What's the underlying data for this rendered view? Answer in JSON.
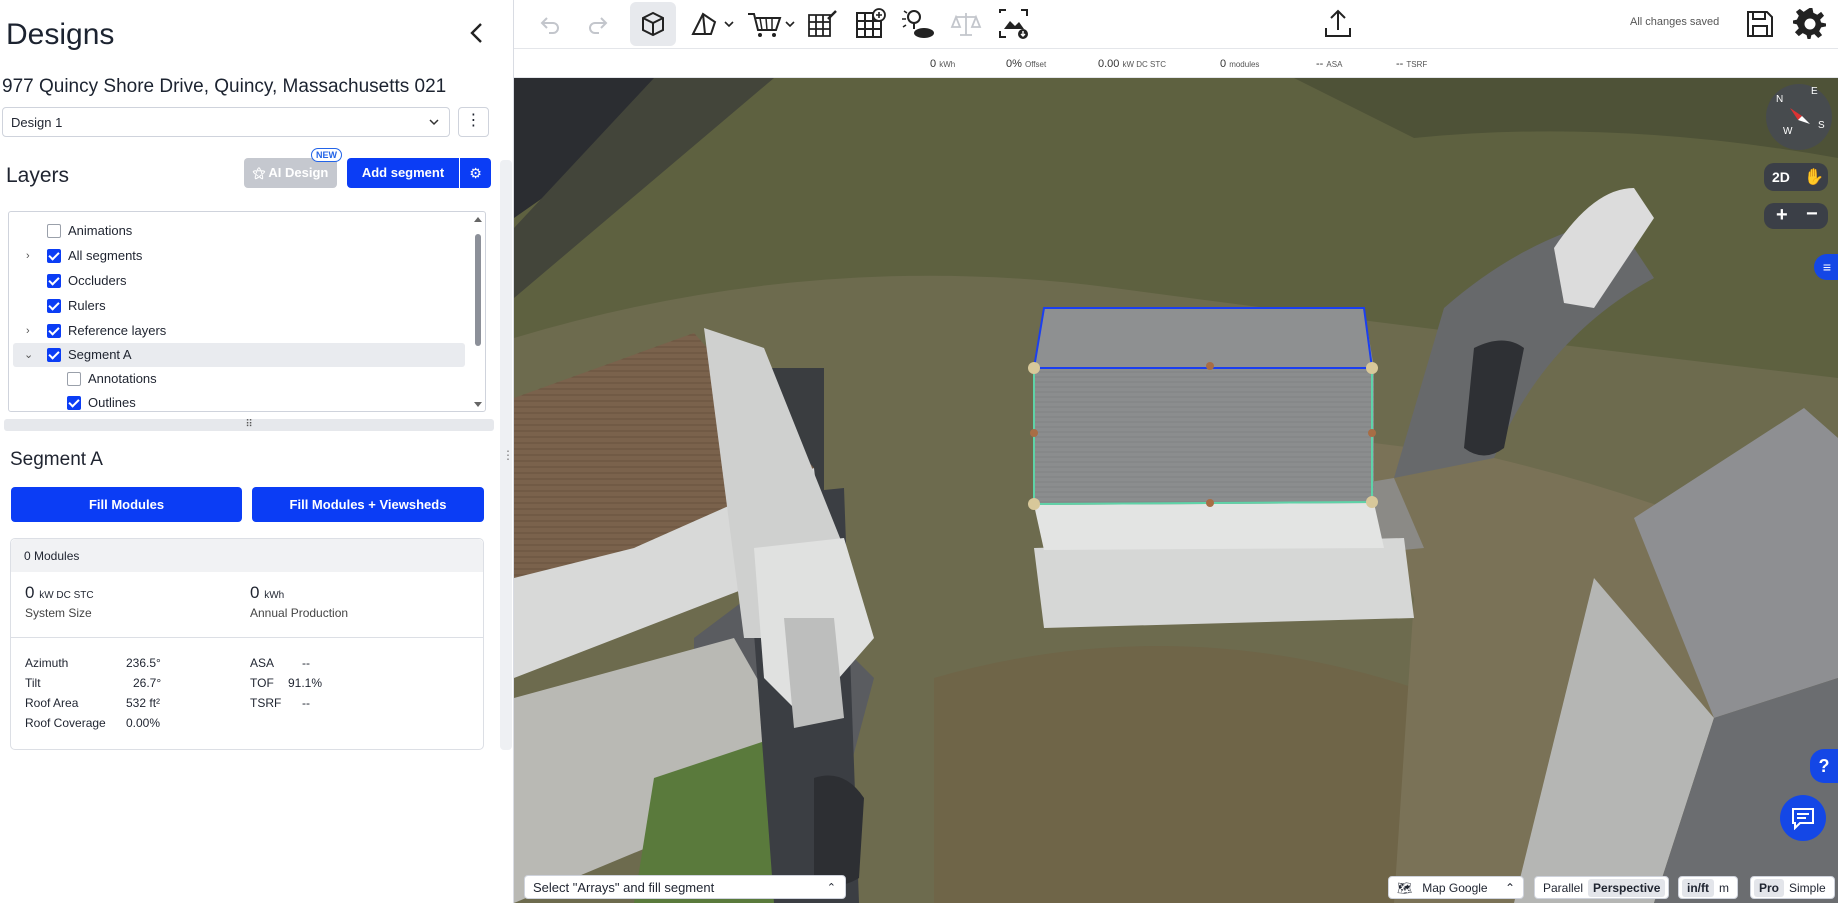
{
  "sidebar": {
    "title": "Designs",
    "address": "977 Quincy Shore Drive, Quincy, Massachusetts 021",
    "design_select": "Design 1",
    "layers_title": "Layers",
    "ai_design_label": "AI Design",
    "new_badge": "NEW",
    "add_segment_label": "Add segment",
    "layers": [
      {
        "label": "Animations",
        "checked": false,
        "expandable": false
      },
      {
        "label": "All segments",
        "checked": true,
        "expandable": true
      },
      {
        "label": "Occluders",
        "checked": true,
        "expandable": false
      },
      {
        "label": "Rulers",
        "checked": true,
        "expandable": false
      },
      {
        "label": "Reference layers",
        "checked": true,
        "expandable": true
      },
      {
        "label": "Segment A",
        "checked": true,
        "expanded": true,
        "selected": true
      },
      {
        "label": "Annotations",
        "checked": false,
        "child": true
      },
      {
        "label": "Outlines",
        "checked": true,
        "child": true
      }
    ]
  },
  "segment": {
    "title": "Segment A",
    "fill_modules": "Fill Modules",
    "fill_modules_viewsheds": "Fill Modules + Viewsheds",
    "modules_header": "0 Modules",
    "system_size_value": "0",
    "system_size_unit": "kW DC STC",
    "system_size_caption": "System Size",
    "annual_value": "0",
    "annual_unit": "kWh",
    "annual_caption": "Annual Production",
    "left_props": [
      {
        "k": "Azimuth",
        "v": "236.5°"
      },
      {
        "k": "Tilt",
        "v": "26.7°"
      },
      {
        "k": "Roof Area",
        "v": "532 ft²"
      },
      {
        "k": "Roof Coverage",
        "v": "0.00%"
      }
    ],
    "right_props": [
      {
        "k": "ASA",
        "v": "--"
      },
      {
        "k": "TOF",
        "v": "91.1%"
      },
      {
        "k": "TSRF",
        "v": "--"
      }
    ]
  },
  "toolbar": {
    "icons": [
      "undo-icon",
      "redo-icon",
      "3d-box-icon",
      "roof-icon",
      "cart-icon",
      "grid-edit-icon",
      "panel-add-icon",
      "tree-icon",
      "balance-icon",
      "image-export-icon"
    ],
    "upload_icon": "upload-icon",
    "saved_text": "All changes saved",
    "save_icon": "save-icon",
    "settings_icon": "gear-icon"
  },
  "stats": [
    {
      "value": "0",
      "unit": "kWh"
    },
    {
      "value": "0%",
      "unit": "Offset"
    },
    {
      "value": "0.00",
      "unit": "kW DC STC"
    },
    {
      "value": "0",
      "unit": "modules"
    },
    {
      "value": "--",
      "unit": "ASA"
    },
    {
      "value": "--",
      "unit": "TSRF"
    }
  ],
  "map": {
    "compass": {
      "n": "N",
      "e": "E",
      "w": "W",
      "s": "S"
    },
    "view_2d": "2D",
    "zoom_in": "+",
    "zoom_out": "−",
    "bottom_hint": "Select \"Arrays\" and fill segment",
    "map_source": "Map Google",
    "projection": [
      "Parallel",
      "Perspective"
    ],
    "units": [
      "in/ft",
      "m"
    ],
    "mode": [
      "Pro",
      "Simple"
    ],
    "help": "?"
  },
  "colors": {
    "accent": "#0b3df5",
    "segment_outline": "#1b3ff0",
    "segment_fill_edge": "#5fd3a8"
  }
}
